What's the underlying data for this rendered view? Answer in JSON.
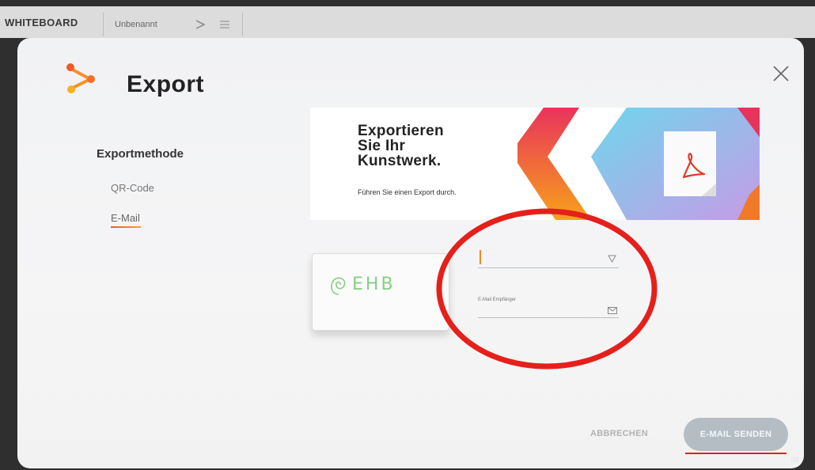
{
  "app": {
    "title": "WHITEBOARD",
    "document_name": "Unbenannt"
  },
  "dialog": {
    "title": "Export",
    "section_label": "Exportmethode",
    "methods": [
      {
        "label": "QR-Code",
        "selected": false
      },
      {
        "label": "E-Mail",
        "selected": true
      }
    ]
  },
  "banner": {
    "heading_line1": "Exportieren",
    "heading_line2": "Sie Ihr",
    "heading_line3": "Kunstwerk.",
    "subtext": "Führen Sie einen Export durch."
  },
  "preview": {
    "sketch_text": "EHB"
  },
  "form": {
    "field1_value": "",
    "recipient_label": "E-Mail Empfänger",
    "recipient_value": ""
  },
  "footer": {
    "cancel_label": "ABBRECHEN",
    "send_label": "E-MAIL SENDEN"
  },
  "corner_text": "[O]",
  "colors": {
    "accent_orange": "#f05a28",
    "accent_yellow": "#f7a21b",
    "accent_pink": "#e8335d",
    "accent_cyan": "#6fd6ec",
    "highlight_red": "#e5201b",
    "send_button": "#b4bdc4"
  }
}
